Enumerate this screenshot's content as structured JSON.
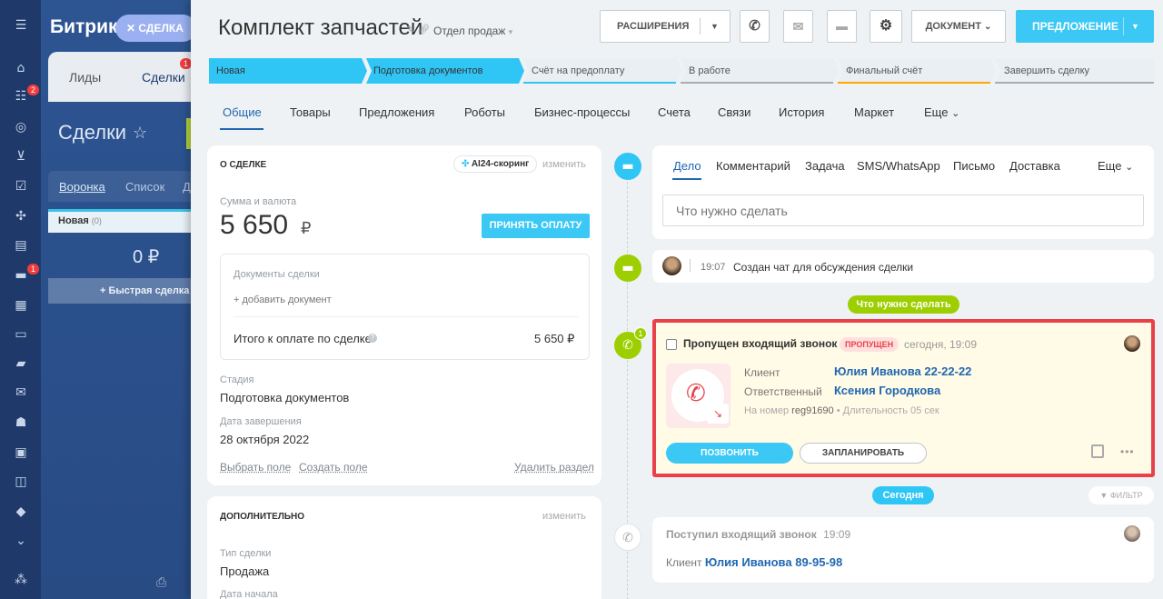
{
  "bg": {
    "logo": "Битрикс",
    "chip": "СДЕЛКА",
    "tabs": {
      "leads": "Лиды",
      "deals": "Сделки",
      "deals_badge": "1"
    },
    "title": "Сделки",
    "view_funnel": "Воронка",
    "view_list": "Список",
    "view_more": "Д",
    "column_new": "Новая",
    "column_new_count": "(0)",
    "column_sum": "0 ₽",
    "quick_deal": "+ Быстрая сделка"
  },
  "rail": {
    "badge_1": "2",
    "badge_2": "1"
  },
  "header": {
    "title": "Комплект запчастей",
    "department": "Отдел продаж",
    "extensions": "РАСШИРЕНИЯ",
    "document": "ДОКУМЕНТ",
    "proposal": "ПРЕДЛОЖЕНИЕ"
  },
  "stages": [
    {
      "label": "Новая"
    },
    {
      "label": "Подготовка документов"
    },
    {
      "label": "Счёт на предоплату"
    },
    {
      "label": "В работе"
    },
    {
      "label": "Финальный счёт"
    },
    {
      "label": "Завершить сделку"
    }
  ],
  "tabs": [
    "Общие",
    "Товары",
    "Предложения",
    "Роботы",
    "Бизнес-процессы",
    "Счета",
    "Связи",
    "История",
    "Маркет",
    "Еще"
  ],
  "about": {
    "heading": "О СДЕЛКЕ",
    "scoring": "AI24-скоринг",
    "edit": "изменить",
    "sum_label": "Сумма и валюта",
    "sum": "5 650",
    "currency": "₽",
    "accept_payment": "ПРИНЯТЬ ОПЛАТУ",
    "docs_label": "Документы сделки",
    "add_doc": "+ добавить документ",
    "total_label": "Итого к оплате по сделке",
    "total": "5 650 ₽",
    "stage_label": "Стадия",
    "stage": "Подготовка документов",
    "close_label": "Дата завершения",
    "close_date": "28 октября 2022",
    "select_field": "Выбрать поле",
    "create_field": "Создать поле",
    "delete_section": "Удалить раздел"
  },
  "extra": {
    "heading": "ДОПОЛНИТЕЛЬНО",
    "edit": "изменить",
    "type_label": "Тип сделки",
    "type": "Продажа",
    "start_label": "Дата начала"
  },
  "composer": {
    "tabs": [
      "Дело",
      "Комментарий",
      "Задача",
      "SMS/WhatsApp",
      "Письмо",
      "Доставка"
    ],
    "more": "Еще",
    "placeholder": "Что нужно сделать"
  },
  "timeline": {
    "chat_time": "19:07",
    "chat_text": "Создан чат для обсуждения сделки",
    "todo_pill": "Что нужно сделать",
    "call_badge": "1",
    "call": {
      "title": "Пропущен входящий звонок",
      "status": "ПРОПУЩЕН",
      "when": "сегодня, 19:09",
      "client_label": "Клиент",
      "client": "Юлия Иванова 22-22-22",
      "resp_label": "Ответственный",
      "resp": "Ксения Городкова",
      "number_label": "На номер",
      "number": "reg91690",
      "duration": "• Длительность 05 сек",
      "call_btn": "ПОЗВОНИТЬ",
      "plan_btn": "ЗАПЛАНИРОВАТЬ",
      "more": "•••"
    },
    "today_pill": "Сегодня",
    "filter": "ФИЛЬТР",
    "incoming": {
      "title": "Поступил входящий звонок",
      "time": "19:09",
      "client_label": "Клиент",
      "client": "Юлия Иванова 89-95-98"
    }
  },
  "colors": {
    "accent": "#2fc6f6",
    "brand": "#1f3a6a",
    "green": "#9dcf00",
    "highlight": "#e8414a"
  }
}
